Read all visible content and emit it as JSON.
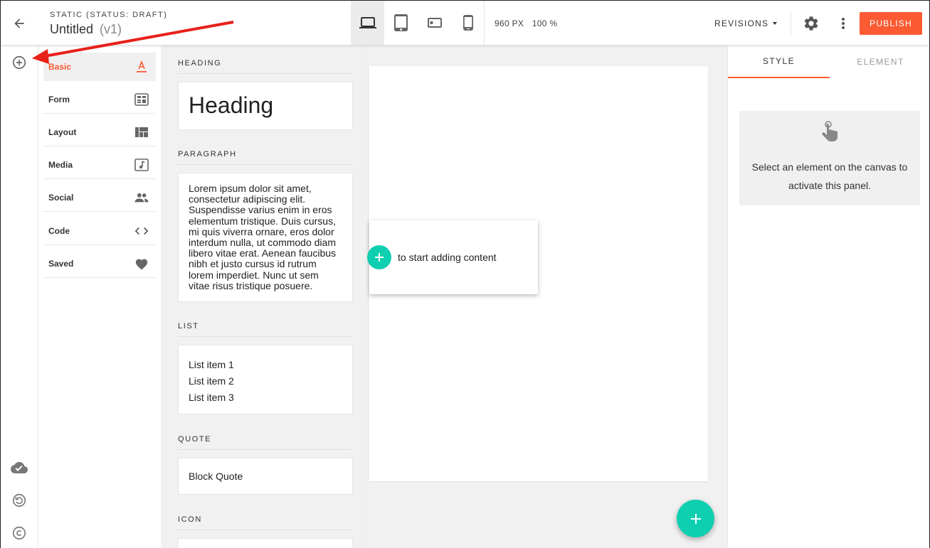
{
  "header": {
    "status": "STATIC (STATUS: DRAFT)",
    "title": "Untitled",
    "version": "(v1)",
    "width": "960 PX",
    "zoom": "100 %",
    "revisions": "REVISIONS",
    "publish": "PUBLISH"
  },
  "categories": [
    {
      "label": "Basic",
      "icon": "text-format-icon",
      "active": true
    },
    {
      "label": "Form",
      "icon": "form-icon"
    },
    {
      "label": "Layout",
      "icon": "layout-icon"
    },
    {
      "label": "Media",
      "icon": "media-icon"
    },
    {
      "label": "Social",
      "icon": "people-icon"
    },
    {
      "label": "Code",
      "icon": "code-icon"
    },
    {
      "label": "Saved",
      "icon": "heart-icon"
    }
  ],
  "blocks": {
    "heading_label": "HEADING",
    "heading_text": "Heading",
    "paragraph_label": "PARAGRAPH",
    "paragraph_text": "Lorem ipsum dolor sit amet, consectetur adipiscing elit. Suspendisse varius enim in eros elementum tristique. Duis cursus, mi quis viverra ornare, eros dolor interdum nulla, ut commodo diam libero vitae erat. Aenean faucibus nibh et justo cursus id rutrum lorem imperdiet. Nunc ut sem vitae risus tristique posuere.",
    "list_label": "LIST",
    "list_items": [
      "List item 1",
      "List item 2",
      "List item 3"
    ],
    "quote_label": "QUOTE",
    "quote_text": "Block Quote",
    "icon_label": "ICON"
  },
  "canvas": {
    "hint": "to start adding content"
  },
  "panel": {
    "tab_style": "STYLE",
    "tab_element": "ELEMENT",
    "message": "Select an element on the canvas to activate this panel."
  },
  "colors": {
    "accent": "#fb5a32",
    "teal": "#0ecfaf",
    "annotation_arrow": "#e8201a"
  }
}
